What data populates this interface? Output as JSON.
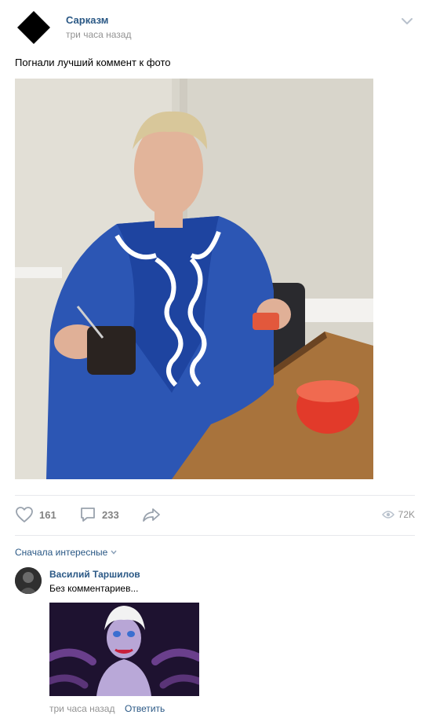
{
  "post": {
    "group_name": "Сарказм",
    "time": "три часа назад",
    "text": "Погнали лучший коммент к фото",
    "menu_icon": "chevron-down-icon",
    "photo_icon": "post-photo"
  },
  "actions": {
    "likes": "161",
    "comments": "233",
    "views": "72K",
    "icons": [
      "heart-icon",
      "comment-icon",
      "share-icon",
      "eye-icon"
    ]
  },
  "comments_section": {
    "sort_label": "Сначала интересные",
    "items": [
      {
        "author": "Василий Таршилов",
        "text": "Без комментариев...",
        "time": "три часа назад",
        "reply_label": "Ответить"
      }
    ]
  },
  "colors": {
    "link": "#2a5885",
    "muted": "#939393",
    "divider": "#e7e8ec",
    "icon": "#99a2ad"
  }
}
